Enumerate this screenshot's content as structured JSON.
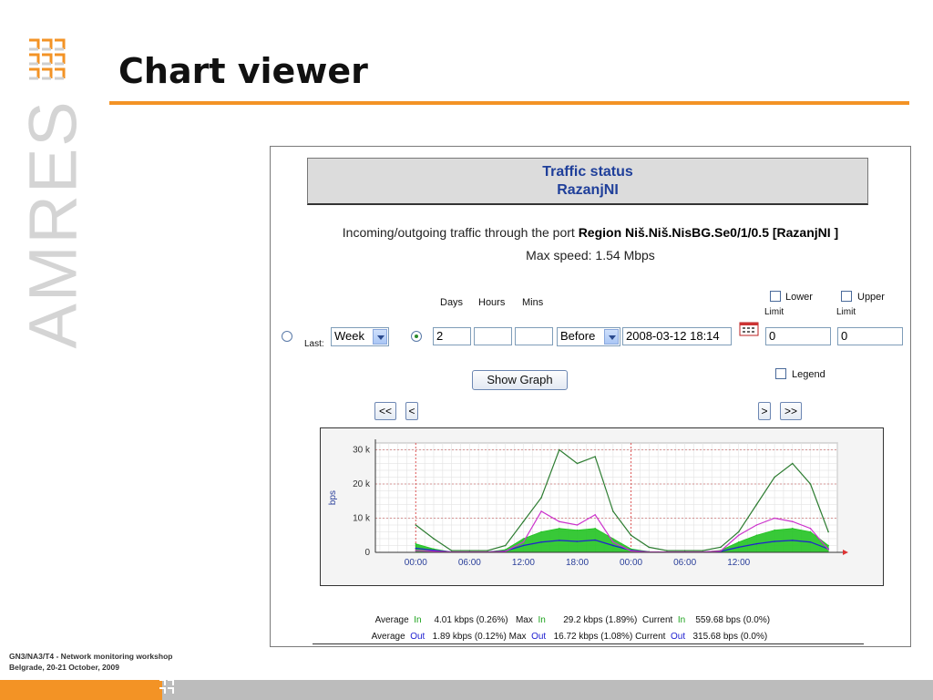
{
  "slide": {
    "brand": "AMRES",
    "title": "Chart viewer",
    "footer_line1": "GN3/NA3/T4 - Network monitoring workshop",
    "footer_line2": "Belgrade, 20-21 October, 2009"
  },
  "app": {
    "heading_line1": "Traffic status",
    "heading_line2": "RazanjNI",
    "port_prefix": "Incoming/outgoing traffic through the port",
    "port_name": "Region Niš.Niš.NisBG.Se0/1/0.5 [RazanjNI ]",
    "max_speed": "Max speed: 1.54 Mbps"
  },
  "form": {
    "last_label": "Last:",
    "last_option": "Week",
    "days_label": "Days",
    "hours_label": "Hours",
    "mins_label": "Mins",
    "days_value": "2",
    "hours_value": "",
    "mins_value": "",
    "relation_option": "Before",
    "date_value": "2008-03-12 18:14",
    "lower_label_1": "Lower",
    "lower_label_2": "Limit",
    "upper_label_1": "Upper",
    "upper_label_2": "Limit",
    "lower_value": "0",
    "upper_value": "0",
    "legend_label": "Legend",
    "show_graph_label": "Show Graph",
    "nav_first": "<<",
    "nav_prev": "<",
    "nav_next": ">",
    "nav_last": ">>",
    "radio_last_selected": false,
    "radio_range_selected": true
  },
  "stats": {
    "row1": [
      "Average",
      "In",
      "4.01 kbps (0.26%)",
      "Max",
      "In",
      "29.2 kbps (1.89%)",
      "Current",
      "In",
      "559.68 bps (0.0%)"
    ],
    "row2": [
      "Average",
      "Out",
      "1.89 kbps (0.12%)",
      "Max",
      "Out",
      "16.72 kbps (1.08%)",
      "Current",
      "Out",
      "315.68 bps (0.0%)"
    ]
  },
  "chart_data": {
    "type": "area",
    "ylabel": "bps",
    "ylim": [
      0,
      32000
    ],
    "y_ticks": [
      0,
      10000,
      20000,
      30000
    ],
    "y_tick_labels": [
      "0",
      "10 k",
      "20 k",
      "30 k"
    ],
    "x_tick_labels": [
      "00:00",
      "06:00",
      "12:00",
      "18:00",
      "00:00",
      "06:00",
      "12:00"
    ],
    "x_hours": [
      0,
      2,
      4,
      6,
      8,
      10,
      12,
      14,
      16,
      18,
      20,
      22,
      24,
      26,
      28,
      30,
      32,
      34,
      36,
      38,
      40,
      42,
      44,
      46
    ],
    "xlim_hours": [
      -4.5,
      47
    ],
    "x_tick_hours": [
      0,
      6,
      12,
      18,
      24,
      30,
      36
    ],
    "series": [
      {
        "name": "Max In",
        "color": "#2e7d32",
        "kind": "line",
        "values": [
          8000,
          4000,
          500,
          500,
          500,
          2000,
          9000,
          16000,
          30000,
          26000,
          28000,
          12000,
          5000,
          1500,
          500,
          500,
          500,
          1500,
          6000,
          14000,
          22000,
          26000,
          20000,
          6000
        ]
      },
      {
        "name": "Average In",
        "color": "#22c322",
        "kind": "area",
        "values": [
          2500,
          1000,
          100,
          100,
          100,
          800,
          4000,
          6000,
          7000,
          6500,
          7000,
          4000,
          1000,
          200,
          100,
          100,
          100,
          600,
          3000,
          5000,
          6500,
          7000,
          6000,
          2000
        ]
      },
      {
        "name": "Average Out",
        "color": "#2020d0",
        "kind": "line",
        "values": [
          1200,
          600,
          100,
          100,
          100,
          400,
          2000,
          3000,
          3500,
          3200,
          3600,
          2000,
          600,
          100,
          100,
          100,
          100,
          300,
          1500,
          2500,
          3200,
          3500,
          3000,
          1000
        ]
      },
      {
        "name": "Max Out",
        "color": "#cc33cc",
        "kind": "line",
        "values": [
          500,
          300,
          100,
          100,
          100,
          300,
          3000,
          12000,
          9000,
          8000,
          11000,
          3000,
          400,
          100,
          100,
          100,
          100,
          400,
          5000,
          8000,
          10000,
          9000,
          7000,
          800
        ]
      }
    ],
    "grid": true,
    "legend": "none"
  }
}
